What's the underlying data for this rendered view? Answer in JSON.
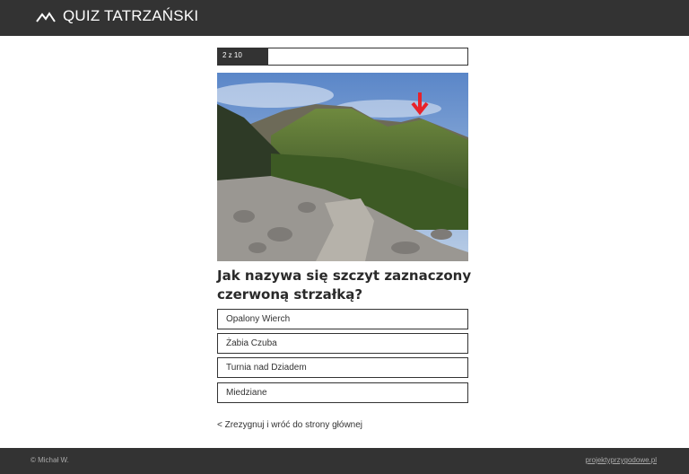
{
  "header": {
    "title": "QUIZ TATRZAŃSKI",
    "logo_icon": "mountain-icon"
  },
  "progress": {
    "label": "2 z 10",
    "fraction": 0.2
  },
  "photo": {
    "alt_semantic": "mountain-photo"
  },
  "question": "Jak nazywa się szczyt zaznaczony czerwoną strzałką?",
  "answers": [
    "Opalony Wierch",
    "Żabia Czuba",
    "Turnia nad Dziadem",
    "Miedziane"
  ],
  "back_link": "< Zrezygnuj i wróć do strony głównej",
  "footer": {
    "left": "© Michał W.",
    "right": "projektyprzygodowe.pl"
  },
  "colors": {
    "bar": "#333333",
    "arrow": "#e8222a",
    "background": "#ffffff"
  }
}
